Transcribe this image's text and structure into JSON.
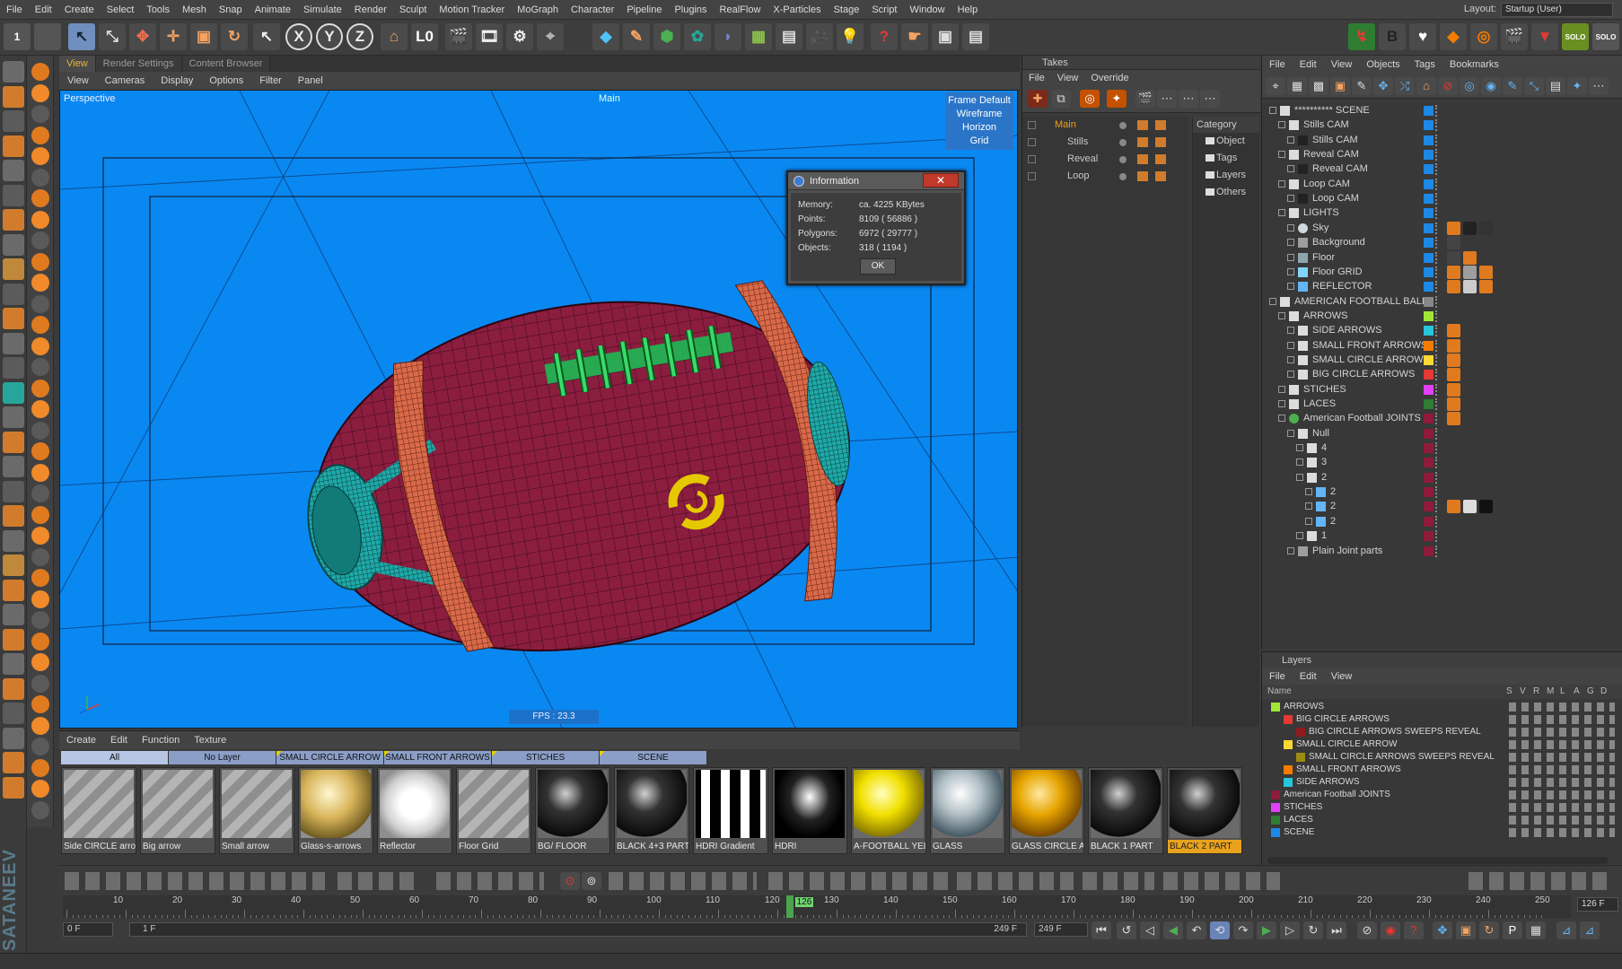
{
  "menu": [
    "File",
    "Edit",
    "Create",
    "Select",
    "Tools",
    "Mesh",
    "Snap",
    "Animate",
    "Simulate",
    "Render",
    "Sculpt",
    "Motion Tracker",
    "MoGraph",
    "Character",
    "Pipeline",
    "Plugins",
    "RealFlow",
    "X-Particles",
    "Stage",
    "Script",
    "Window",
    "Help"
  ],
  "layout": {
    "label": "Layout:",
    "value": "Startup (User)"
  },
  "viewport_tabs": [
    "View",
    "Render Settings",
    "Content Browser"
  ],
  "viewport_menu": [
    "View",
    "Cameras",
    "Display",
    "Options",
    "Filter",
    "Panel"
  ],
  "viewport": {
    "camera": "Perspective",
    "take": "Main",
    "overlay": [
      "Frame Default",
      "Wireframe",
      "Horizon",
      "Grid"
    ],
    "fps": "FPS : 23.3"
  },
  "info_dialog": {
    "title": "Information",
    "rows": [
      {
        "k": "Memory:",
        "v": "ca. 4225 KBytes"
      },
      {
        "k": "Points:",
        "v": "8109 ( 56886 )"
      },
      {
        "k": "Polygons:",
        "v": "6972 ( 29777 )"
      },
      {
        "k": "Objects:",
        "v": "318 ( 1194 )"
      }
    ],
    "ok": "OK"
  },
  "takes": {
    "title": "Takes",
    "menu": [
      "File",
      "View",
      "Override"
    ],
    "rows": [
      "Main",
      "Stills",
      "Reveal",
      "Loop"
    ],
    "category_header": "Category",
    "categories": [
      "Object",
      "Tags",
      "Layers",
      "Others"
    ]
  },
  "objects": {
    "menu": [
      "File",
      "Edit",
      "View",
      "Objects",
      "Tags",
      "Bookmarks"
    ],
    "rows": [
      {
        "name": "********** SCENE",
        "indent": 0,
        "icon": "L0",
        "color": "#1e88e5"
      },
      {
        "name": "Stills CAM",
        "indent": 1,
        "icon": "L0",
        "color": "#1e88e5"
      },
      {
        "name": "Stills CAM",
        "indent": 2,
        "icon": "cam",
        "color": "#1e88e5"
      },
      {
        "name": "Reveal CAM",
        "indent": 1,
        "icon": "L0",
        "color": "#1e88e5"
      },
      {
        "name": "Reveal CAM",
        "indent": 2,
        "icon": "cam",
        "color": "#1e88e5"
      },
      {
        "name": "Loop CAM",
        "indent": 1,
        "icon": "L0",
        "color": "#1e88e5"
      },
      {
        "name": "Loop CAM",
        "indent": 2,
        "icon": "cam",
        "color": "#1e88e5"
      },
      {
        "name": "LIGHTS",
        "indent": 1,
        "icon": "L0",
        "color": "#1e88e5"
      },
      {
        "name": "Sky",
        "indent": 2,
        "icon": "sky",
        "color": "#1e88e5"
      },
      {
        "name": "Background",
        "indent": 2,
        "icon": "bg",
        "color": "#1e88e5"
      },
      {
        "name": "Floor",
        "indent": 2,
        "icon": "floor",
        "color": "#1e88e5"
      },
      {
        "name": "Floor GRID",
        "indent": 2,
        "icon": "grid",
        "color": "#1e88e5"
      },
      {
        "name": "REFLECTOR",
        "indent": 2,
        "icon": "refl",
        "color": "#1e88e5"
      },
      {
        "name": "AMERICAN FOOTBALL BALL",
        "indent": 0,
        "icon": "L0",
        "color": "#888888"
      },
      {
        "name": "ARROWS",
        "indent": 1,
        "icon": "L0",
        "color": "#a3e635"
      },
      {
        "name": "SIDE ARROWS",
        "indent": 2,
        "icon": "L0",
        "color": "#26c6da"
      },
      {
        "name": "SMALL FRONT ARROWS",
        "indent": 2,
        "icon": "L0",
        "color": "#f57c00"
      },
      {
        "name": "SMALL CIRCLE ARROWS",
        "indent": 2,
        "icon": "L0",
        "color": "#fdd835"
      },
      {
        "name": "BIG CIRCLE ARROWS",
        "indent": 2,
        "icon": "L0",
        "color": "#e53935"
      },
      {
        "name": "STICHES",
        "indent": 1,
        "icon": "L0",
        "color": "#e040fb"
      },
      {
        "name": "LACES",
        "indent": 1,
        "icon": "L0",
        "color": "#2e7d32"
      },
      {
        "name": "American Football JOINTS",
        "indent": 1,
        "icon": "joint",
        "color": "#8e1b3b"
      },
      {
        "name": "Null",
        "indent": 2,
        "icon": "L0",
        "color": "#8e1b3b"
      },
      {
        "name": "4",
        "indent": 3,
        "icon": "L0",
        "color": "#8e1b3b"
      },
      {
        "name": "3",
        "indent": 3,
        "icon": "L0",
        "color": "#8e1b3b"
      },
      {
        "name": "2",
        "indent": 3,
        "icon": "L0",
        "color": "#8e1b3b"
      },
      {
        "name": "2",
        "indent": 4,
        "icon": "bone",
        "color": "#8e1b3b"
      },
      {
        "name": "2",
        "indent": 4,
        "icon": "bone",
        "color": "#8e1b3b"
      },
      {
        "name": "2",
        "indent": 4,
        "icon": "bone",
        "color": "#8e1b3b"
      },
      {
        "name": "1",
        "indent": 3,
        "icon": "L0",
        "color": "#8e1b3b"
      },
      {
        "name": "Plain Joint parts",
        "indent": 2,
        "icon": "part",
        "color": "#8e1b3b"
      }
    ]
  },
  "layers": {
    "title": "Layers",
    "menu": [
      "File",
      "Edit",
      "View"
    ],
    "col_name": "Name",
    "cols": [
      "S",
      "V",
      "R",
      "M",
      "L",
      "A",
      "G",
      "D"
    ],
    "rows": [
      {
        "name": "ARROWS",
        "indent": 0,
        "color": "#a3e635"
      },
      {
        "name": "BIG CIRCLE ARROWS",
        "indent": 1,
        "color": "#e53935"
      },
      {
        "name": "BIG CIRCLE ARROWS SWEEPS REVEAL",
        "indent": 2,
        "color": "#8e1b1b"
      },
      {
        "name": "SMALL CIRCLE ARROW",
        "indent": 1,
        "color": "#fdd835"
      },
      {
        "name": "SMALL CIRCLE ARROWS SWEEPS REVEAL",
        "indent": 2,
        "color": "#9e8c10"
      },
      {
        "name": "SMALL FRONT ARROWS",
        "indent": 1,
        "color": "#f57c00"
      },
      {
        "name": "SIDE ARROWS",
        "indent": 1,
        "color": "#26c6da"
      },
      {
        "name": "American Football JOINTS",
        "indent": 0,
        "color": "#8e1b3b"
      },
      {
        "name": "STICHES",
        "indent": 0,
        "color": "#e040fb"
      },
      {
        "name": "LACES",
        "indent": 0,
        "color": "#2e7d32"
      },
      {
        "name": "SCENE",
        "indent": 0,
        "color": "#1e88e5"
      }
    ]
  },
  "materials": {
    "menu": [
      "Create",
      "Edit",
      "Function",
      "Texture"
    ],
    "tabs": [
      "All",
      "No Layer",
      "SMALL CIRCLE ARROW",
      "SMALL FRONT ARROWS",
      "STICHES",
      "SCENE"
    ],
    "items": [
      {
        "label": "Side CIRCLE arro",
        "kind": "stripe"
      },
      {
        "label": "Big arrow",
        "kind": "stripe"
      },
      {
        "label": "Small arrow",
        "kind": "stripe"
      },
      {
        "label": "Glass-s-arrows",
        "kind": "glassy"
      },
      {
        "label": "Reflector",
        "kind": "white"
      },
      {
        "label": "Floor Grid",
        "kind": "stripe"
      },
      {
        "label": "BG/ FLOOR",
        "kind": "black"
      },
      {
        "label": "BLACK 4+3 PARTS",
        "kind": "black"
      },
      {
        "label": "HDRI Gradient",
        "kind": "bars"
      },
      {
        "label": "HDRI",
        "kind": "hdri"
      },
      {
        "label": "A-FOOTBALL YELL",
        "kind": "yellow"
      },
      {
        "label": "GLASS",
        "kind": "glass"
      },
      {
        "label": "GLASS CIRCLE AR",
        "kind": "amber"
      },
      {
        "label": "BLACK 1 PART",
        "kind": "black"
      },
      {
        "label": "BLACK 2 PART",
        "kind": "black",
        "selected": true
      }
    ]
  },
  "timeline": {
    "ticks": [
      "10",
      "20",
      "30",
      "40",
      "50",
      "60",
      "70",
      "80",
      "90",
      "100",
      "110",
      "120",
      "130",
      "140",
      "150",
      "160",
      "170",
      "180",
      "190",
      "200",
      "210",
      "220",
      "230",
      "240",
      "250"
    ],
    "playhead_frame": "126",
    "current_frame": "126 F",
    "start_field": "0 F",
    "range_start": "1 F",
    "range_end": "249 F",
    "end_field": "249 F"
  },
  "watermark": "SATANEEV"
}
